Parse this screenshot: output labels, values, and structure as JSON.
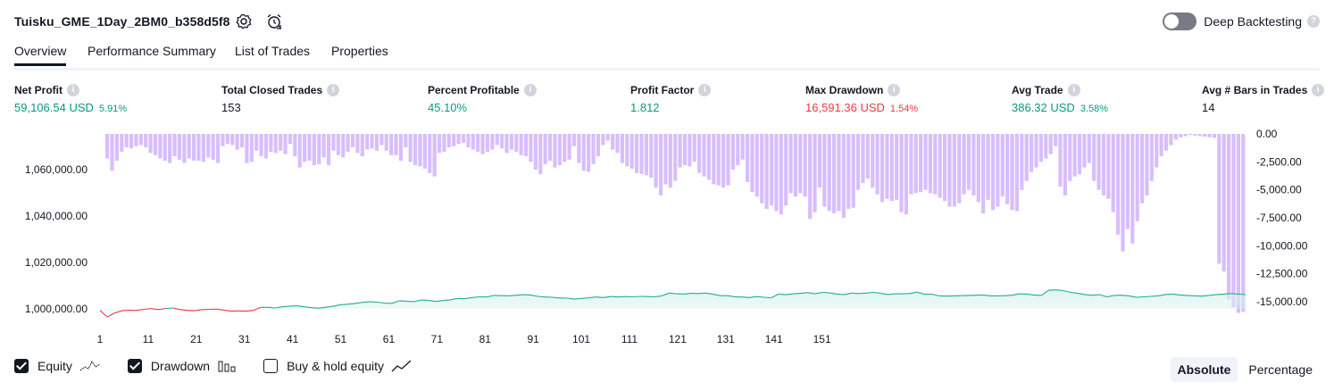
{
  "header": {
    "strategy_title": "Tuisku_GME_1Day_2BM0_b358d5f8",
    "settings_icon": "gear-icon",
    "alert_icon": "alarm-clock-icon",
    "deep_backtesting_label": "Deep Backtesting",
    "deep_backtesting_on": false
  },
  "tabs": [
    "Overview",
    "Performance Summary",
    "List of Trades",
    "Properties"
  ],
  "active_tab": "Overview",
  "metrics": [
    {
      "label": "Net Profit",
      "value": "59,106.54 USD",
      "pct": "5.91%",
      "tone": "pos"
    },
    {
      "label": "Total Closed Trades",
      "value": "153",
      "pct": "",
      "tone": "plain"
    },
    {
      "label": "Percent Profitable",
      "value": "45.10%",
      "pct": "",
      "tone": "pos"
    },
    {
      "label": "Profit Factor",
      "value": "1.812",
      "pct": "",
      "tone": "pos"
    },
    {
      "label": "Max Drawdown",
      "value": "16,591.36 USD",
      "pct": "1.54%",
      "tone": "neg"
    },
    {
      "label": "Avg Trade",
      "value": "386.32 USD",
      "pct": "3.58%",
      "tone": "pos"
    },
    {
      "label": "Avg # Bars in Trades",
      "value": "14",
      "pct": "",
      "tone": "plain"
    }
  ],
  "legend": {
    "equity_label": "Equity",
    "equity_checked": true,
    "drawdown_label": "Drawdown",
    "drawdown_checked": true,
    "buyhold_label": "Buy & hold equity",
    "buyhold_checked": false
  },
  "mode_buttons": {
    "absolute": "Absolute",
    "percentage": "Percentage",
    "active": "Absolute"
  },
  "chart_data": {
    "type": "line",
    "x_ticks": [
      1,
      11,
      21,
      31,
      41,
      51,
      61,
      71,
      81,
      91,
      101,
      111,
      121,
      131,
      141,
      151
    ],
    "y_left_ticks": [
      "1,000,000.00",
      "1,020,000.00",
      "1,040,000.00",
      "1,060,000.00"
    ],
    "y_left_values": [
      1000000,
      1020000,
      1040000,
      1060000
    ],
    "y_right_ticks": [
      "0.00",
      "-2,500.00",
      "-5,000.00",
      "-7,500.00",
      "-10,000.00",
      "-12,500.00",
      "-15,000.00"
    ],
    "y_right_values": [
      0,
      -2500,
      -5000,
      -7500,
      -10000,
      -12500,
      -15000
    ],
    "colors": {
      "equity_up": "#22ab94",
      "equity_down": "#f23645",
      "equity_fill": "#d6f2ec",
      "drawdown": "#d1b3fc"
    },
    "series": [
      {
        "name": "Equity",
        "values": [
          999300,
          996500,
          998200,
          999200,
          999400,
          999300,
          999800,
          1000100,
          999700,
          1000200,
          1000400,
          999700,
          999300,
          999200,
          999700,
          999800,
          999900,
          999400,
          999000,
          999100,
          999000,
          999300,
          1000600,
          1000700,
          1000400,
          1000900,
          1001200,
          1001300,
          1000900,
          1000500,
          1000300,
          1000700,
          1001200,
          1001800,
          1002000,
          1002400,
          1002800,
          1003100,
          1002900,
          1002500,
          1002400,
          1003500,
          1003300,
          1003100,
          1003800,
          1003700,
          1003200,
          1003600,
          1003900,
          1004500,
          1004400,
          1004900,
          1005200,
          1005100,
          1005800,
          1005700,
          1005600,
          1005900,
          1006100,
          1006000,
          1005400,
          1005100,
          1005000,
          1004700,
          1004600,
          1004200,
          1004500,
          1004800,
          1005100,
          1004900,
          1005300,
          1005100,
          1005300,
          1005200,
          1005400,
          1005300,
          1005200,
          1005600,
          1006800,
          1006500,
          1006400,
          1006700,
          1006600,
          1006800,
          1006300,
          1005700,
          1005700,
          1005200,
          1005100,
          1004900,
          1005300,
          1005000,
          1004800,
          1006400,
          1006100,
          1006500,
          1006700,
          1007000,
          1006500,
          1007100,
          1006900,
          1006400,
          1006200,
          1006800,
          1006600,
          1006800,
          1007100,
          1006700,
          1006200,
          1006500,
          1006500,
          1006600,
          1007200,
          1006300,
          1006300,
          1005600,
          1005500,
          1005600,
          1005700,
          1005800,
          1005900,
          1006000,
          1005600,
          1005600,
          1005700,
          1005900,
          1006500,
          1006400,
          1006000,
          1005800,
          1008000,
          1008200,
          1007900,
          1007100,
          1006700,
          1006100,
          1005900,
          1006100,
          1005200,
          1005800,
          1005900,
          1005600,
          1005000,
          1005200,
          1005400,
          1005600,
          1006200,
          1006400,
          1006000,
          1005800,
          1005600,
          1005500,
          1005800,
          1006200,
          1006400,
          1006600,
          1006300,
          1006200
        ]
      },
      {
        "name": "Drawdown",
        "values": [
          0,
          -2200,
          -3300,
          -2400,
          -1600,
          -1200,
          -1300,
          -1100,
          -1000,
          -1200,
          -1700,
          -1900,
          -2200,
          -2400,
          -2600,
          -2000,
          -2300,
          -2600,
          -2200,
          -2400,
          -2400,
          -2500,
          -2100,
          -2300,
          -2600,
          -1100,
          -900,
          -1000,
          -1400,
          -1200,
          -2600,
          -2500,
          -1500,
          -2000,
          -2200,
          -1600,
          -1700,
          -1500,
          -1800,
          -900,
          -2000,
          -3000,
          -2500,
          -2400,
          -2800,
          -2700,
          -2100,
          -2800,
          -1500,
          -1900,
          -2100,
          -1600,
          -1200,
          -1700,
          -2000,
          -1400,
          -1300,
          -1500,
          -1000,
          -1500,
          -1900,
          -1900,
          -2400,
          -1200,
          -2500,
          -2800,
          -2900,
          -3100,
          -3500,
          -3800,
          -1700,
          -1600,
          -1200,
          -1100,
          -900,
          -800,
          -1200,
          -1400,
          -1600,
          -1800,
          -1600,
          -1400,
          -1000,
          -1300,
          -1700,
          -1400,
          -1600,
          -1900,
          -2000,
          -2500,
          -3200,
          -3600,
          -2700,
          -2400,
          -3000,
          -2800,
          -2500,
          -2300,
          -1100,
          -2600,
          -3300,
          -3400,
          -2700,
          -2000,
          -1000,
          -600,
          -1400,
          -1700,
          -2600,
          -2900,
          -3100,
          -3500,
          -3600,
          -3700,
          -3900,
          -4800,
          -5500,
          -4500,
          -4800,
          -4200,
          -3000,
          -2800,
          -2900,
          -2500,
          -3500,
          -3800,
          -4100,
          -4500,
          -4600,
          -4800,
          -4600,
          -3200,
          -2800,
          -2300,
          -4300,
          -5200,
          -5600,
          -6200,
          -6700,
          -6400,
          -6900,
          -7200,
          -6400,
          -5300,
          -5600,
          -5300,
          -5600,
          -7600,
          -7000,
          -4800,
          -6500,
          -6900,
          -7100,
          -6900,
          -7500,
          -6700,
          -6600,
          -5000,
          -4400,
          -4000,
          -4800,
          -5400,
          -6100,
          -5800,
          -6000,
          -5900,
          -7000,
          -7200,
          -5400,
          -5300,
          -5200,
          -5000,
          -5300,
          -5400,
          -5700,
          -6000,
          -6500,
          -6500,
          -6200,
          -5400,
          -5000,
          -5500,
          -6100,
          -7100,
          -5900,
          -6800,
          -6500,
          -5600,
          -6300,
          -6800,
          -6900,
          -5000,
          -4200,
          -3400,
          -3000,
          -2500,
          -2200,
          -1800,
          -1100,
          -4700,
          -5500,
          -4200,
          -3800,
          -3600,
          -3000,
          -2600,
          -4200,
          -5000,
          -5500,
          -5800,
          -7000,
          -9000,
          -10500,
          -8500,
          -9800,
          -7800,
          -6200,
          -5500,
          -4200,
          -3000,
          -2000,
          -1500,
          -1000,
          -500,
          -300,
          -200,
          -100,
          -150,
          -200,
          -250,
          -300,
          -350,
          -11600,
          -12300,
          -14800,
          -15500,
          -16000,
          -15900
        ]
      }
    ]
  }
}
